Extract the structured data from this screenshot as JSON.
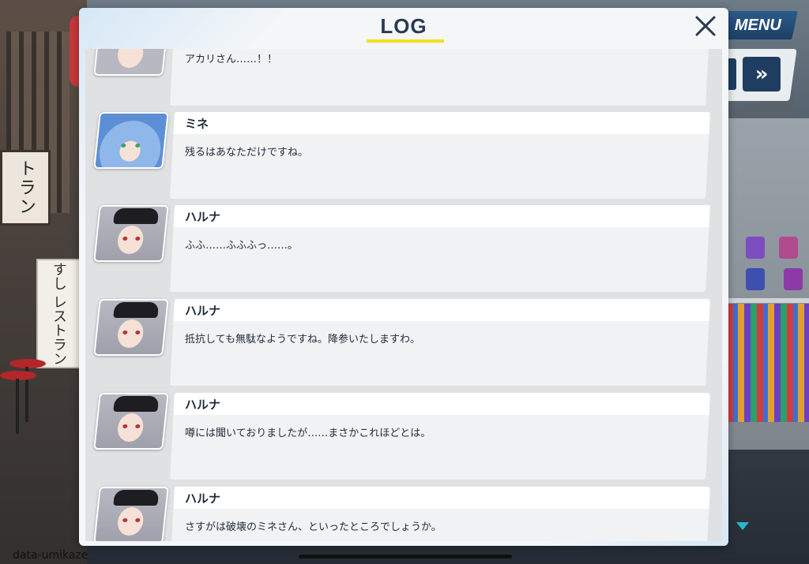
{
  "background": {
    "shop_sign": "トラン",
    "vertical_sign": "すし レストラン"
  },
  "hud": {
    "menu_label": "MENU",
    "fast_forward_label": "»"
  },
  "dialog": {
    "title": "LOG",
    "close_label": "✕",
    "accent_color": "#f4e11c",
    "entries": [
      {
        "speaker": "",
        "message": "アカリさん……！！",
        "avatar": "haruna"
      },
      {
        "speaker": "ミネ",
        "message": "残るはあなただけですね。",
        "avatar": "mine"
      },
      {
        "speaker": "ハルナ",
        "message": "ふふ……ふふふっ……。",
        "avatar": "haruna"
      },
      {
        "speaker": "ハルナ",
        "message": "抵抗しても無駄なようですね。降参いたしますわ。",
        "avatar": "haruna"
      },
      {
        "speaker": "ハルナ",
        "message": "噂には聞いておりましたが……まさかこれほどとは。",
        "avatar": "haruna"
      },
      {
        "speaker": "ハルナ",
        "message": "さすがは破壊のミネさん、といったところでしょうか。",
        "avatar": "haruna"
      }
    ]
  },
  "footer": {
    "watermark": "data-umikaze"
  }
}
